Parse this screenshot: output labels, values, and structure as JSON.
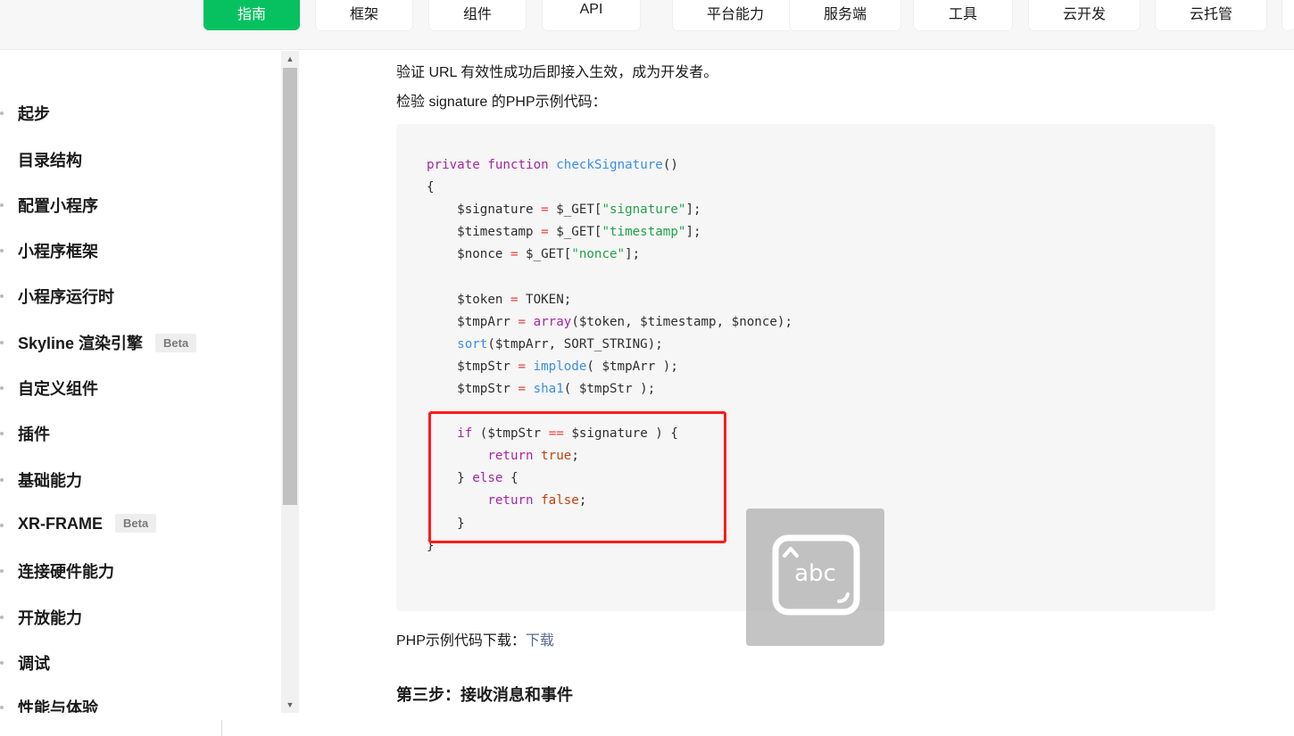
{
  "topnav": {
    "tabs": [
      {
        "label": "指南",
        "active": true
      },
      {
        "label": "框架"
      },
      {
        "label": "组件"
      },
      {
        "label": "API"
      },
      {
        "label": "平台能力"
      },
      {
        "label": "服务端"
      },
      {
        "label": "工具"
      },
      {
        "label": "云开发"
      },
      {
        "label": "云托管"
      },
      {
        "label": ""
      }
    ]
  },
  "sidebar": {
    "items": [
      {
        "label": "起步"
      },
      {
        "label": "目录结构"
      },
      {
        "label": "配置小程序"
      },
      {
        "label": "小程序框架"
      },
      {
        "label": "小程序运行时"
      },
      {
        "label": "Skyline 渲染引擎",
        "badge": "Beta"
      },
      {
        "label": "自定义组件"
      },
      {
        "label": "插件"
      },
      {
        "label": "基础能力"
      },
      {
        "label": "XR-FRAME",
        "badge": "Beta"
      },
      {
        "label": "连接硬件能力"
      },
      {
        "label": "开放能力"
      },
      {
        "label": "调试"
      },
      {
        "label": "性能与体验"
      }
    ]
  },
  "content": {
    "para1": "验证 URL 有效性成功后即接入生效，成为开发者。",
    "para2": "检验 signature 的PHP示例代码：",
    "download_prefix": "PHP示例代码下载：",
    "download_link": "下载",
    "next_heading": "第三步：接收消息和事件"
  },
  "keyboard_overlay": {
    "label": "abc",
    "icon": "keyboard-abc-icon"
  },
  "colors": {
    "accent": "#07c160",
    "link": "#576b95",
    "highlight_box": "#ff1a1a"
  }
}
